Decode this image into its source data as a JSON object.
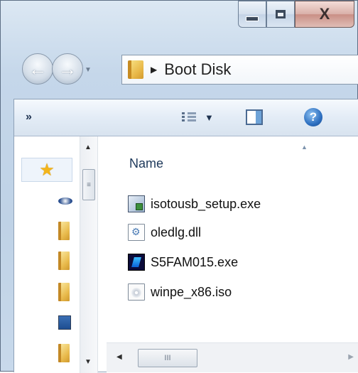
{
  "window": {
    "caption_buttons": {
      "minimize": "minimize-icon",
      "maximize": "maximize-icon",
      "close": "X"
    }
  },
  "navigation": {
    "back_icon": "back-arrow-icon",
    "forward_icon": "forward-arrow-icon",
    "recent_icon": "chevron-down-icon",
    "address": {
      "separator": "▶",
      "path": "Boot Disk"
    }
  },
  "toolbar": {
    "overflow": "»",
    "views_dropdown": "▼",
    "help": "?"
  },
  "nav_pane": {
    "items": [
      {
        "icon": "favorites-star-icon"
      },
      {
        "icon": "drive-icon"
      },
      {
        "icon": "folder-icon"
      },
      {
        "icon": "folder-icon"
      },
      {
        "icon": "folder-icon"
      },
      {
        "icon": "desktop-icon"
      },
      {
        "icon": "folder-icon"
      }
    ]
  },
  "files": {
    "column_header": "Name",
    "items": [
      {
        "name": "isotousb_setup.exe",
        "icon": "setup-exe-icon"
      },
      {
        "name": "oledlg.dll",
        "icon": "dll-file-icon"
      },
      {
        "name": "S5FAM015.exe",
        "icon": "application-exe-icon"
      },
      {
        "name": "winpe_x86.iso",
        "icon": "disc-image-icon"
      }
    ]
  },
  "scrollbars": {
    "vertical_up": "▲",
    "vertical_down": "▼",
    "vertical_grip": "≡",
    "horizontal_left": "◀",
    "horizontal_right": "▶",
    "horizontal_grip": "III"
  },
  "colors": {
    "chrome": "#c5d7ea",
    "accent": "#1e395b",
    "help": "#2d6fc0"
  }
}
